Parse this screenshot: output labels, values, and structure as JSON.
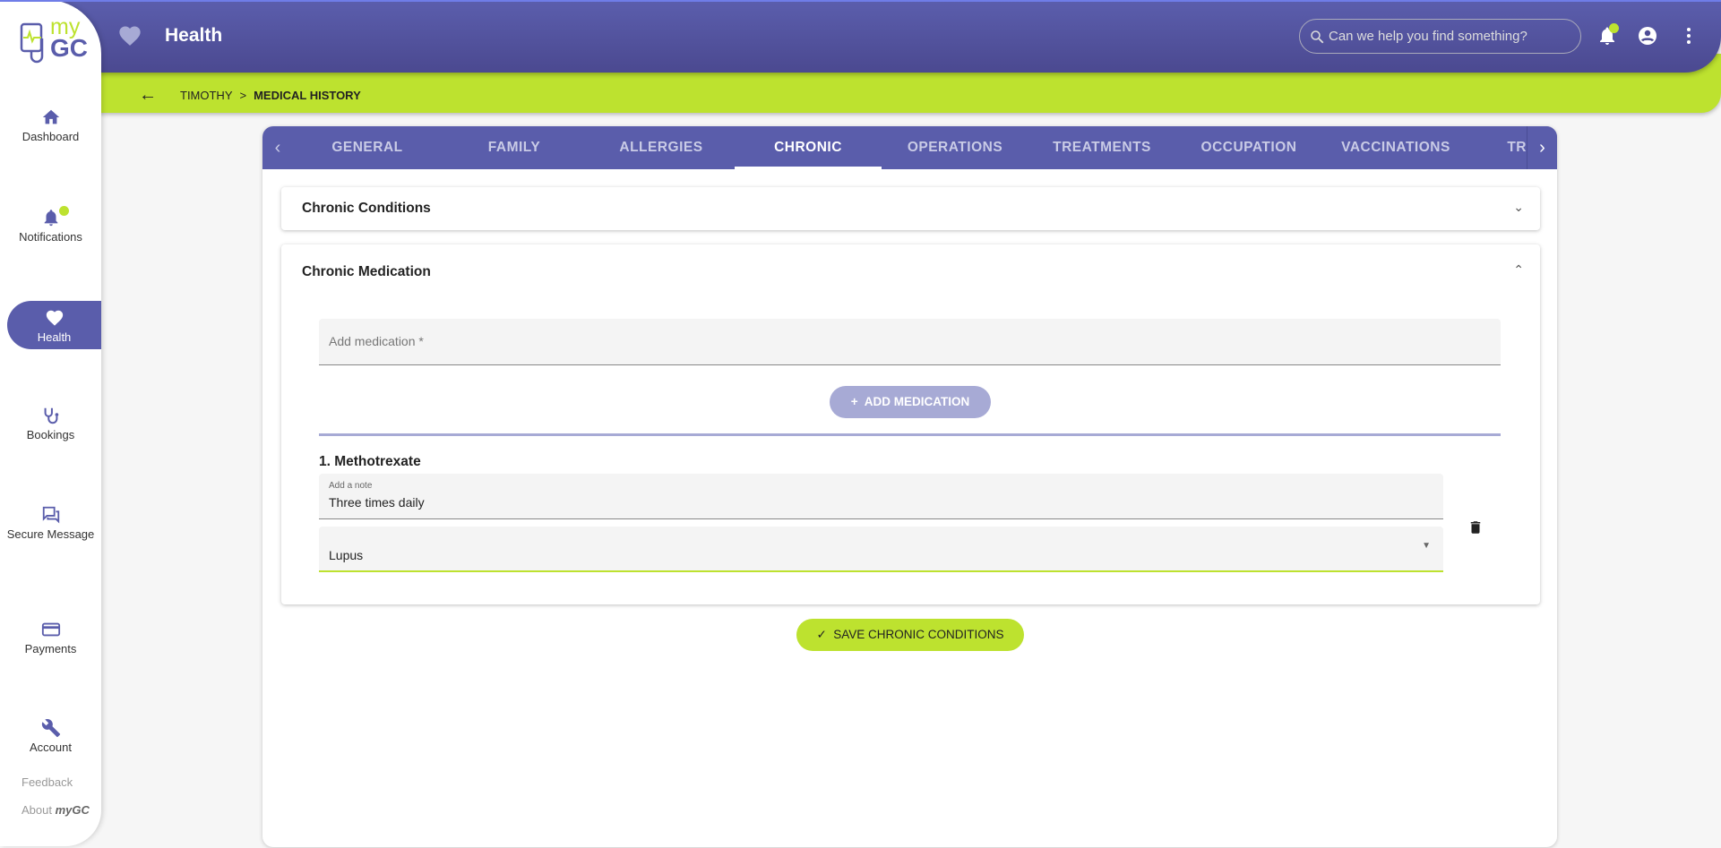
{
  "header": {
    "title": "Health",
    "search_placeholder": "Can we help you find something?"
  },
  "logo": {
    "my": "my",
    "gc": "GC"
  },
  "breadcrumb": {
    "parent": "TIMOTHY",
    "separator": ">",
    "current": "MEDICAL HISTORY"
  },
  "sidebar": {
    "items": [
      {
        "label": "Dashboard"
      },
      {
        "label": "Notifications"
      },
      {
        "label": "Health"
      },
      {
        "label": "Bookings"
      },
      {
        "label": "Secure Message"
      },
      {
        "label": "Payments"
      },
      {
        "label": "Account"
      }
    ],
    "feedback": "Feedback",
    "about": "About",
    "about_brand": "myGC"
  },
  "tabs": [
    {
      "label": "GENERAL"
    },
    {
      "label": "FAMILY"
    },
    {
      "label": "ALLERGIES"
    },
    {
      "label": "CHRONIC"
    },
    {
      "label": "OPERATIONS"
    },
    {
      "label": "TREATMENTS"
    },
    {
      "label": "OCCUPATION"
    },
    {
      "label": "VACCINATIONS"
    },
    {
      "label": "TR"
    }
  ],
  "panels": {
    "conditions": "Chronic Conditions",
    "medication": "Chronic Medication"
  },
  "form": {
    "add_placeholder": "Add medication *",
    "add_button": "ADD MEDICATION",
    "item_title": "1. Methotrexate",
    "note_label": "Add a note",
    "note_value": "Three times daily",
    "condition_value": "Lupus"
  },
  "save_button": "SAVE CHRONIC CONDITIONS",
  "colors": {
    "primary": "#5a5dab",
    "accent": "#bde22f"
  }
}
